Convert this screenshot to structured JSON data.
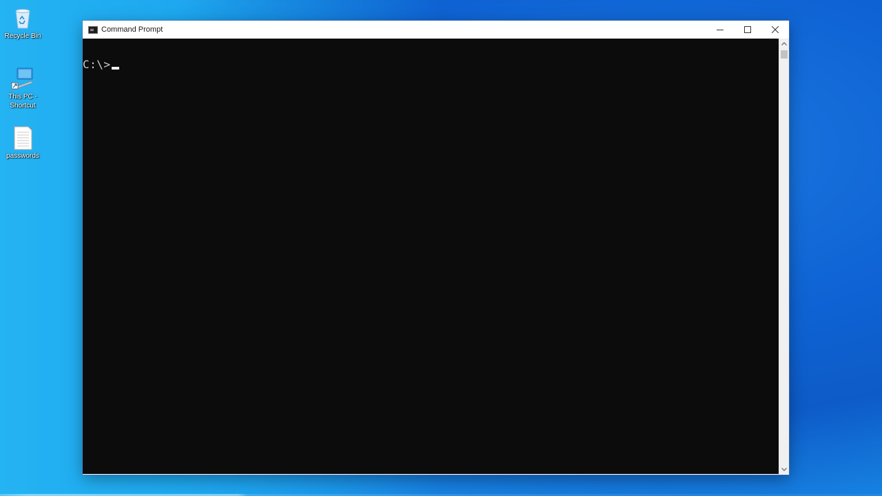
{
  "desktop": {
    "icons": [
      {
        "label": "Recycle Bin",
        "icon": "recycle-bin-icon"
      },
      {
        "label": "This PC -\nShortcut",
        "icon": "computer-icon"
      },
      {
        "label": "passwords",
        "icon": "text-file-icon"
      }
    ]
  },
  "window": {
    "title": "Command Prompt",
    "icon": "console-icon",
    "controls": {
      "minimize": "minimize-icon",
      "maximize": "maximize-icon",
      "close": "close-icon"
    }
  },
  "console": {
    "prompt": "C:\\>",
    "input": ""
  },
  "colors": {
    "console_bg": "#0c0c0c",
    "console_text": "#cccccc",
    "titlebar_bg": "#ffffff",
    "desktop_accent": "#1a78e0"
  }
}
